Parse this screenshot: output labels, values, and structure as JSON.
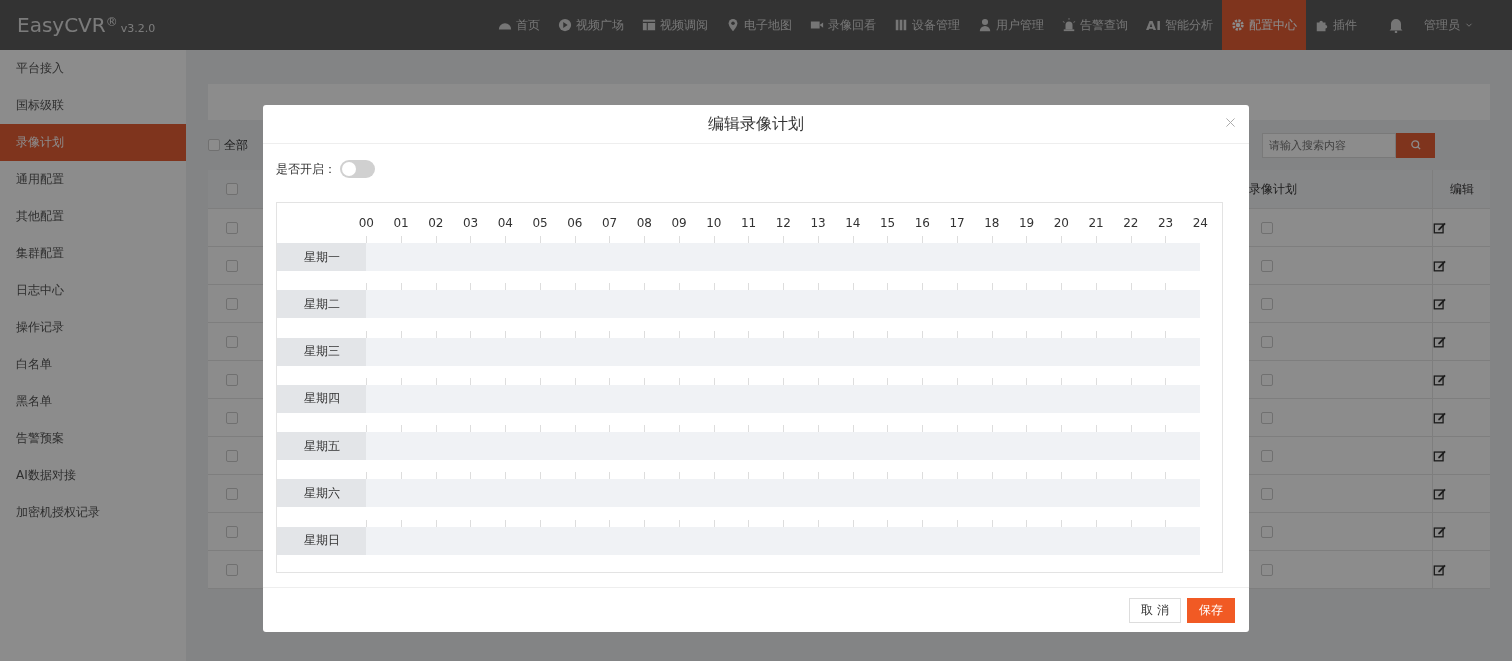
{
  "app": {
    "logo": "EasyCVR",
    "logo_mark": "®",
    "version": "v3.2.0"
  },
  "nav": [
    {
      "label": "首页",
      "selected": false
    },
    {
      "label": "视频广场",
      "selected": false
    },
    {
      "label": "视频调阅",
      "selected": false
    },
    {
      "label": "电子地图",
      "selected": false
    },
    {
      "label": "录像回看",
      "selected": false
    },
    {
      "label": "设备管理",
      "selected": false
    },
    {
      "label": "用户管理",
      "selected": false
    },
    {
      "label": "告警查询",
      "selected": false
    },
    {
      "label": "智能分析",
      "badge": "AI",
      "selected": false
    },
    {
      "label": "配置中心",
      "selected": true
    },
    {
      "label": "插件",
      "selected": false
    }
  ],
  "user": {
    "name": "管理员"
  },
  "sidebar": {
    "items": [
      {
        "label": "平台接入",
        "selected": false
      },
      {
        "label": "国标级联",
        "selected": false
      },
      {
        "label": "录像计划",
        "selected": true
      },
      {
        "label": "通用配置",
        "selected": false
      },
      {
        "label": "其他配置",
        "selected": false
      },
      {
        "label": "集群配置",
        "selected": false
      },
      {
        "label": "日志中心",
        "selected": false
      },
      {
        "label": "操作记录",
        "selected": false
      },
      {
        "label": "白名单",
        "selected": false
      },
      {
        "label": "黑名单",
        "selected": false
      },
      {
        "label": "告警预案",
        "selected": false
      },
      {
        "label": "AI数据对接",
        "selected": false
      },
      {
        "label": "加密机授权记录",
        "selected": false
      }
    ]
  },
  "page": {
    "select_all": {
      "label": "全部",
      "checked": false
    },
    "search": {
      "placeholder": "请输入搜索内容"
    },
    "table": {
      "columns": [
        "录像计划",
        "编辑"
      ],
      "header_checked": false,
      "rows": [
        {
          "checked": false,
          "plan_checked": false
        },
        {
          "checked": false,
          "plan_checked": false
        },
        {
          "checked": false,
          "plan_checked": false
        },
        {
          "checked": false,
          "plan_checked": false
        },
        {
          "checked": false,
          "plan_checked": false
        },
        {
          "checked": false,
          "plan_checked": false
        },
        {
          "checked": false,
          "plan_checked": false
        },
        {
          "checked": false,
          "plan_checked": false
        },
        {
          "checked": false,
          "plan_checked": false
        },
        {
          "checked": false,
          "plan_checked": false
        }
      ]
    }
  },
  "modal": {
    "title": "编辑录像计划",
    "enable_label": "是否开启：",
    "enabled": false,
    "hours": [
      "00",
      "01",
      "02",
      "03",
      "04",
      "05",
      "06",
      "07",
      "08",
      "09",
      "10",
      "11",
      "12",
      "13",
      "14",
      "15",
      "16",
      "17",
      "18",
      "19",
      "20",
      "21",
      "22",
      "23",
      "24"
    ],
    "days": [
      "星期一",
      "星期二",
      "星期三",
      "星期四",
      "星期五",
      "星期六",
      "星期日"
    ],
    "buttons": [
      {
        "label": "取 消",
        "kind": "default"
      },
      {
        "label": "保存",
        "kind": "primary"
      }
    ]
  }
}
